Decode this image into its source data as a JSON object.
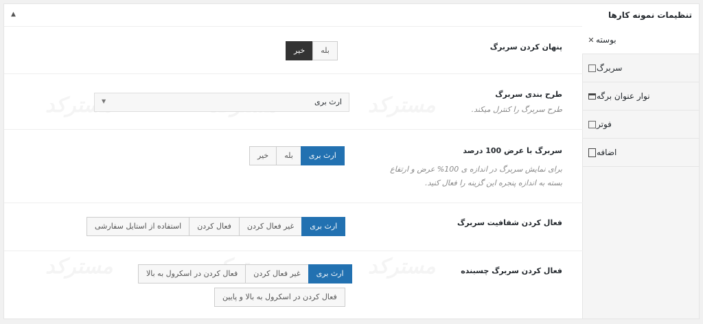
{
  "panel": {
    "title": "تنظیمات نمونه کارها",
    "collapse_icon": "triangle-up-icon"
  },
  "tabs": [
    {
      "label": "بوسته",
      "icon": "wrench-icon",
      "active": true
    },
    {
      "label": "سربرگ",
      "icon": "square-icon",
      "active": false
    },
    {
      "label": "نوار عنوان برگه",
      "icon": "window-icon",
      "active": false
    },
    {
      "label": "فوتر",
      "icon": "square-icon",
      "active": false
    },
    {
      "label": "اضافه",
      "icon": "document-icon",
      "active": false
    }
  ],
  "watermark": "مسترکد",
  "settings": {
    "hide_header": {
      "label": "پنهان کردن سربرگ",
      "options": [
        "بله",
        "خیر"
      ],
      "selected": "خیر"
    },
    "header_layout": {
      "label": "طرح بندی سربرگ",
      "desc": "طرح سربرگ را کنترل میکند.",
      "value": "ارث بری"
    },
    "full_width": {
      "label": "سربرگ با عرض 100 درصد",
      "desc_line1": "برای نمایش سربرگ در اندازه ی 100% عرض و ارتفاع",
      "desc_line2": "بسته به اندازه پنجره این گزینه را فعال کنید.",
      "options": [
        "ارث بری",
        "بله",
        "خیر"
      ],
      "selected": "ارث بری"
    },
    "transparent": {
      "label": "فعال کردن شفافیت سربرگ",
      "options": [
        "ارث بری",
        "غیر فعال کردن",
        "فعال کردن",
        "استفاده از استایل سفارشی"
      ],
      "selected": "ارث بری"
    },
    "sticky": {
      "label": "فعال کردن سربرگ چسبنده",
      "options": [
        "ارث بری",
        "غیر فعال کردن",
        "فعال کردن در اسکرول به بالا"
      ],
      "option_row2": "فعال کردن در اسکرول به بالا و پایین",
      "selected": "ارث بری"
    }
  }
}
